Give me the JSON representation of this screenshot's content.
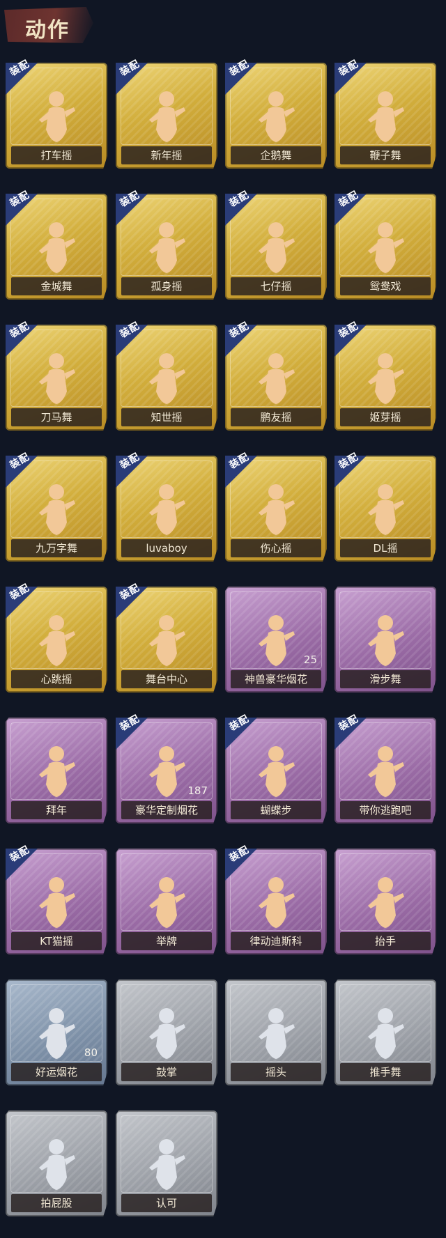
{
  "header": {
    "title": "动作"
  },
  "badge_text": "装配",
  "colors": {
    "gold": "#d2ae3c",
    "purple": "#9b6ca6",
    "blue": "#7c8fa6",
    "gray": "#9a9ea5",
    "badge": "#2a3c78"
  },
  "cards": [
    {
      "label": "打车摇",
      "tier": "gold",
      "equipped": true,
      "icon": "dance-pose-icon"
    },
    {
      "label": "新年摇",
      "tier": "gold",
      "equipped": true,
      "icon": "dance-pose-icon"
    },
    {
      "label": "企鹅舞",
      "tier": "gold",
      "equipped": true,
      "icon": "dance-pose-icon"
    },
    {
      "label": "鞭子舞",
      "tier": "gold",
      "equipped": true,
      "icon": "dance-pose-icon"
    },
    {
      "label": "金城舞",
      "tier": "gold",
      "equipped": true,
      "icon": "dance-pose-icon"
    },
    {
      "label": "孤身摇",
      "tier": "gold",
      "equipped": true,
      "icon": "dance-pose-icon"
    },
    {
      "label": "七仔摇",
      "tier": "gold",
      "equipped": true,
      "icon": "dance-pose-icon"
    },
    {
      "label": "鸳鸯戏",
      "tier": "gold",
      "equipped": true,
      "icon": "dance-pose-icon"
    },
    {
      "label": "刀马舞",
      "tier": "gold",
      "equipped": true,
      "icon": "dance-pose-icon"
    },
    {
      "label": "知世摇",
      "tier": "gold",
      "equipped": true,
      "icon": "dance-pose-icon"
    },
    {
      "label": "鹏友摇",
      "tier": "gold",
      "equipped": true,
      "icon": "dance-pose-icon"
    },
    {
      "label": "姬芽摇",
      "tier": "gold",
      "equipped": true,
      "icon": "dance-pose-icon"
    },
    {
      "label": "九万字舞",
      "tier": "gold",
      "equipped": true,
      "icon": "dance-pose-icon"
    },
    {
      "label": "luvaboy",
      "tier": "gold",
      "equipped": true,
      "icon": "dance-pose-icon"
    },
    {
      "label": "伤心摇",
      "tier": "gold",
      "equipped": true,
      "icon": "heart-hands-pose-icon"
    },
    {
      "label": "DL摇",
      "tier": "gold",
      "equipped": true,
      "icon": "dance-pose-icon"
    },
    {
      "label": "心跳摇",
      "tier": "gold",
      "equipped": true,
      "icon": "dance-pose-icon"
    },
    {
      "label": "舞台中心",
      "tier": "gold",
      "equipped": true,
      "icon": "dance-pose-icon"
    },
    {
      "label": "神兽豪华烟花",
      "tier": "purple",
      "equipped": false,
      "icon": "fireworks-icon",
      "count": "25"
    },
    {
      "label": "滑步舞",
      "tier": "purple",
      "equipped": false,
      "icon": "dance-pose-icon"
    },
    {
      "label": "拜年",
      "tier": "purple",
      "equipped": false,
      "icon": "bow-pose-icon"
    },
    {
      "label": "豪华定制烟花",
      "tier": "purple",
      "equipped": true,
      "icon": "fireworks-box-icon",
      "count": "187"
    },
    {
      "label": "蝴蝶步",
      "tier": "purple",
      "equipped": true,
      "icon": "dance-pose-icon"
    },
    {
      "label": "带你逃跑吧",
      "tier": "purple",
      "equipped": true,
      "icon": "dance-pose-icon"
    },
    {
      "label": "KT猫摇",
      "tier": "purple",
      "equipped": true,
      "icon": "dance-pose-icon"
    },
    {
      "label": "举牌",
      "tier": "purple",
      "equipped": false,
      "icon": "sign-board-icon"
    },
    {
      "label": "律动迪斯科",
      "tier": "purple",
      "equipped": true,
      "icon": "disco-pose-icon"
    },
    {
      "label": "抬手",
      "tier": "purple",
      "equipped": false,
      "icon": "raise-hand-icon"
    },
    {
      "label": "好运烟花",
      "tier": "blue",
      "equipped": false,
      "icon": "firework-can-icon",
      "count": "80"
    },
    {
      "label": "鼓掌",
      "tier": "gray",
      "equipped": false,
      "icon": "clap-hands-icon"
    },
    {
      "label": "摇头",
      "tier": "gray",
      "equipped": false,
      "icon": "shake-head-icon"
    },
    {
      "label": "推手舞",
      "tier": "gray",
      "equipped": false,
      "icon": "push-hands-icon"
    },
    {
      "label": "拍屁股",
      "tier": "gray",
      "equipped": false,
      "icon": "slap-pose-icon"
    },
    {
      "label": "认可",
      "tier": "gray",
      "equipped": false,
      "icon": "thumbs-up-icon"
    }
  ]
}
